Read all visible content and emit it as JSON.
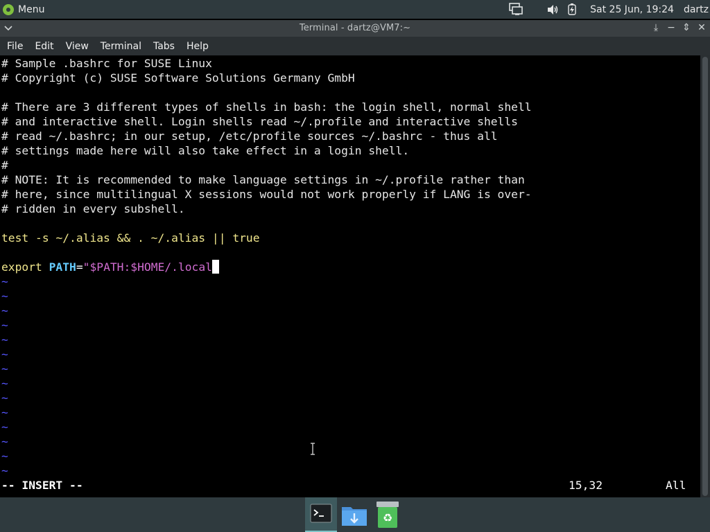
{
  "top_panel": {
    "menu_label": "Menu",
    "clock": "Sat 25 Jun, 19:24",
    "user": "dartz",
    "icons": [
      "network-icon",
      "volume-icon",
      "battery-icon"
    ]
  },
  "window": {
    "title": "Terminal - dartz@VM7:~",
    "controls": [
      "pin-icon",
      "minimize-icon",
      "maximize-icon",
      "close-icon"
    ]
  },
  "menubar": {
    "items": [
      "File",
      "Edit",
      "View",
      "Terminal",
      "Tabs",
      "Help"
    ]
  },
  "editor": {
    "lines": [
      "# Sample .bashrc for SUSE Linux",
      "# Copyright (c) SUSE Software Solutions Germany GmbH",
      "",
      "# There are 3 different types of shells in bash: the login shell, normal shell",
      "# and interactive shell. Login shells read ~/.profile and interactive shells",
      "# read ~/.bashrc; in our setup, /etc/profile sources ~/.bashrc - thus all",
      "# settings made here will also take effect in a login shell.",
      "#",
      "# NOTE: It is recommended to make language settings in ~/.profile rather than",
      "# here, since multilingual X sessions would not work properly if LANG is over-",
      "# ridden in every subshell.",
      "",
      "test -s ~/.alias && . ~/.alias || true",
      "",
      "export PATH=\"$PATH:$HOME/.local"
    ],
    "tilde_count": 14,
    "tilde_char": "~",
    "mode": "-- INSERT --",
    "position": "15,32",
    "scroll": "All"
  },
  "taskbar": {
    "items": [
      {
        "name": "terminal-taskbar-icon",
        "active": true
      },
      {
        "name": "downloads-folder-taskbar-icon",
        "active": false
      },
      {
        "name": "trash-taskbar-icon",
        "active": false
      }
    ]
  }
}
